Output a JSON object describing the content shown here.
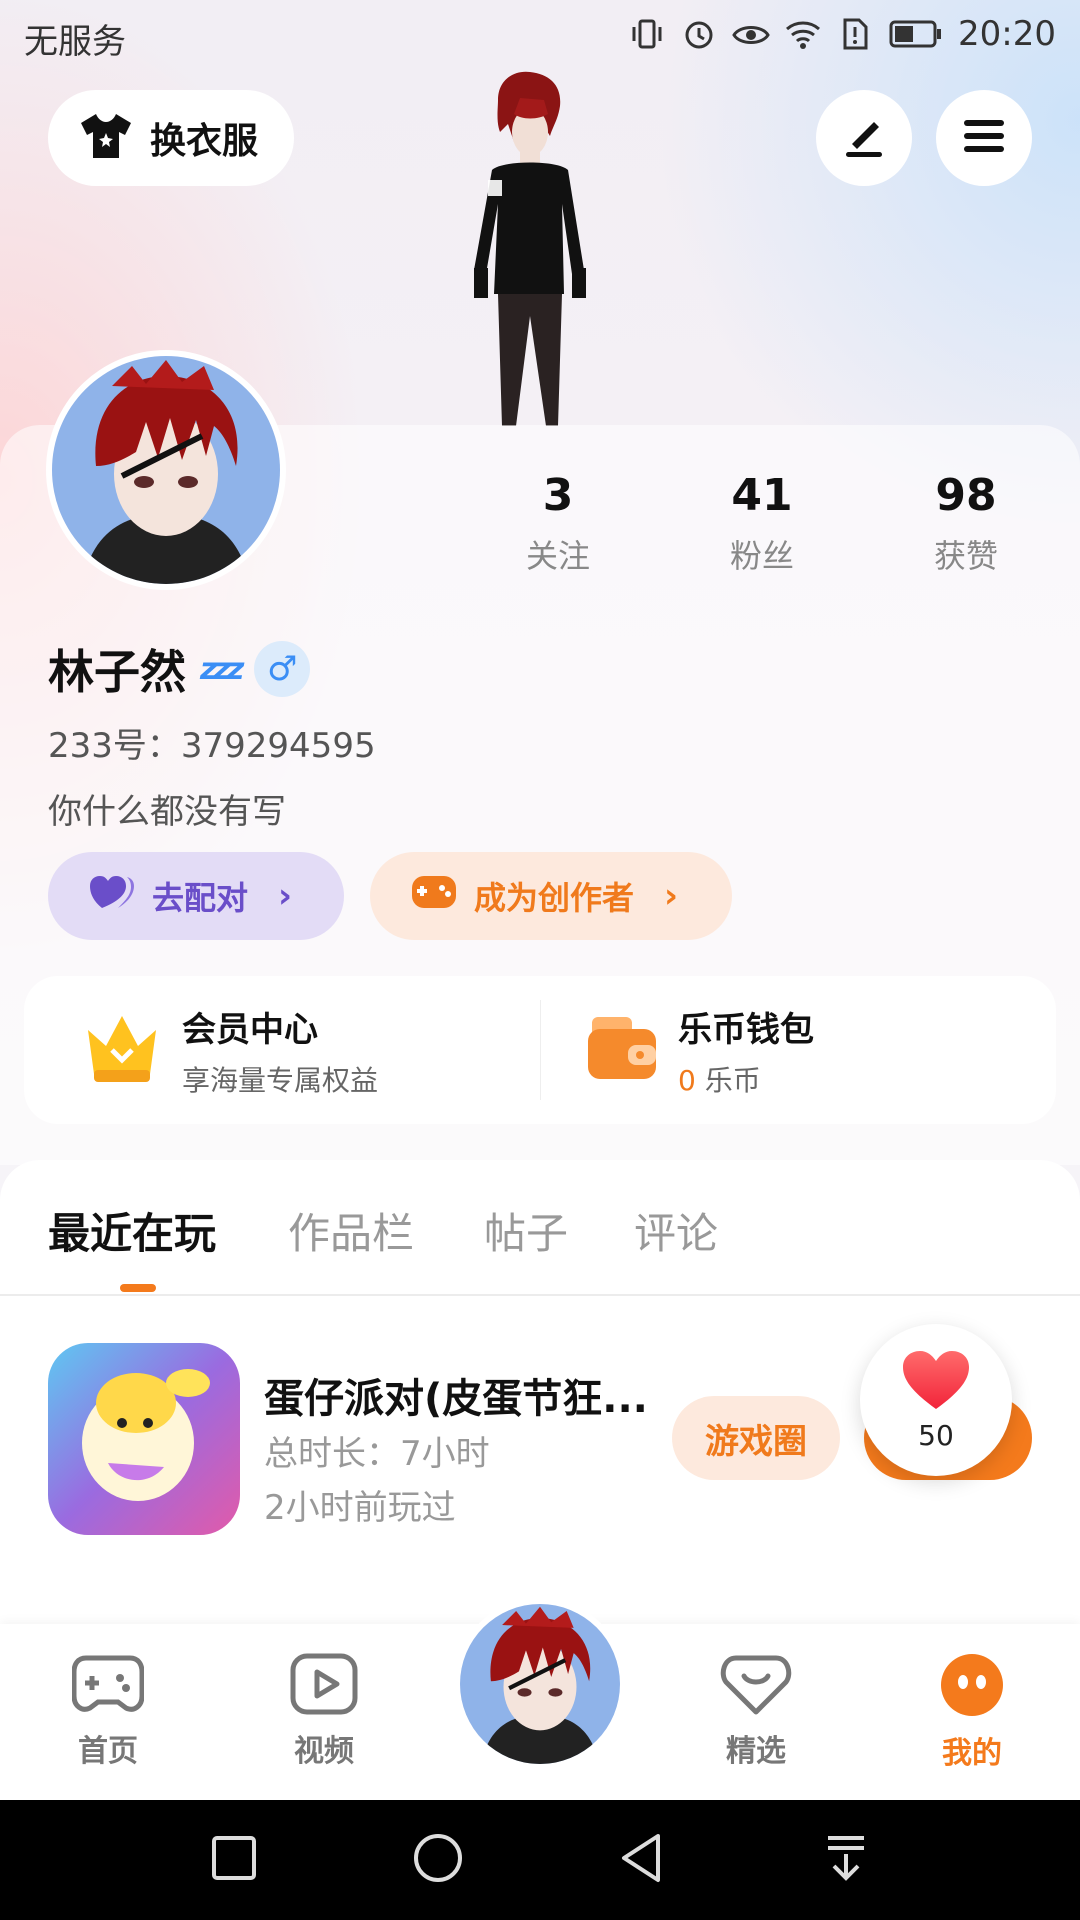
{
  "status_bar": {
    "carrier": "无服务",
    "time": "20:20"
  },
  "top_actions": {
    "wardrobe_label": "换衣服"
  },
  "profile": {
    "name": "林子然",
    "uid": "233号：379294595",
    "bio": "你什么都没有写",
    "stats": [
      {
        "value": "3",
        "label": "关注"
      },
      {
        "value": "41",
        "label": "粉丝"
      },
      {
        "value": "98",
        "label": "获赞"
      }
    ],
    "match_button": "去配对",
    "creator_button": "成为创作者"
  },
  "member_panel": {
    "member": {
      "title": "会员中心",
      "subtitle": "享海量专属权益"
    },
    "wallet": {
      "title": "乐币钱包",
      "amount": "0",
      "unit": "乐币"
    }
  },
  "tabs": [
    "最近在玩",
    "作品栏",
    "帖子",
    "评论"
  ],
  "recent_game": {
    "title": "蛋仔派对(皮蛋节狂...",
    "duration": "总时长：7小时",
    "last_played": "2小时前玩过",
    "circle_button": "游戏圈"
  },
  "like_bubble": {
    "count": "50"
  },
  "bottom_nav": [
    {
      "label": "首页",
      "icon": "gamepad-icon"
    },
    {
      "label": "视频",
      "icon": "play-icon"
    },
    {
      "label": "精选",
      "icon": "heart-chat-icon"
    },
    {
      "label": "我的",
      "icon": "face-icon"
    }
  ],
  "colors": {
    "accent": "#f47a1c",
    "match_purple": "#6a4ec9",
    "gender_blue": "#3b8ef5"
  }
}
